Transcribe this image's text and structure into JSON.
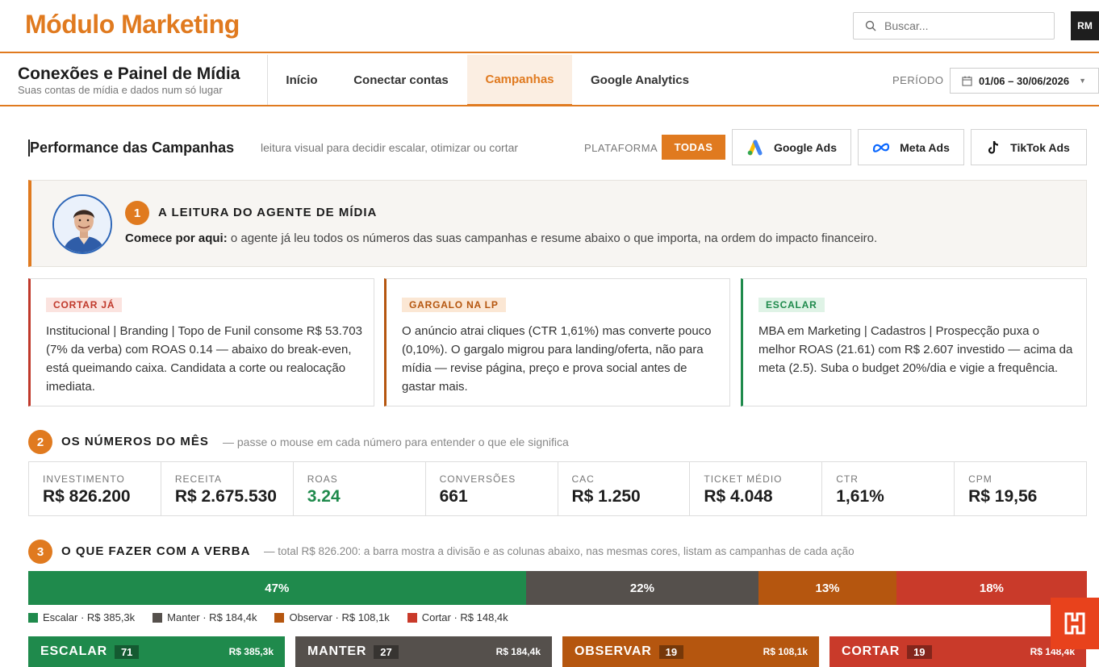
{
  "app": {
    "title": "Módulo Marketing",
    "user_initials": "RM"
  },
  "search": {
    "placeholder": "Buscar..."
  },
  "nav": {
    "brand_title": "Conexões e Painel de Mídia",
    "brand_subtitle": "Suas contas de mídia e dados num só lugar",
    "tabs": [
      {
        "label": "Início",
        "active": false
      },
      {
        "label": "Conectar contas",
        "active": false
      },
      {
        "label": "Campanhas",
        "active": true
      },
      {
        "label": "Google Analytics",
        "active": false
      }
    ],
    "period_label": "PERÍODO",
    "period_value": "01/06 – 30/06/2026"
  },
  "performance": {
    "title": "Performance das Campanhas",
    "subtitle": "leitura visual para decidir escalar, otimizar ou cortar",
    "platform_label": "PLATAFORMA",
    "platforms": [
      {
        "label": "TODAS",
        "icon": "none",
        "active": true
      },
      {
        "label": "Google Ads",
        "icon": "google-ads-icon",
        "active": false
      },
      {
        "label": "Meta Ads",
        "icon": "meta-icon",
        "active": false
      },
      {
        "label": "TikTok Ads",
        "icon": "tiktok-icon",
        "active": false
      }
    ]
  },
  "agent": {
    "step": "1",
    "heading": "A LEITURA DO AGENTE DE MÍDIA",
    "lead": "Comece por aqui:",
    "text": "o agente já leu todos os números das suas campanhas e resume abaixo o que importa, na ordem do impacto financeiro."
  },
  "insights": [
    {
      "tag": "CORTAR JÁ",
      "color": "#c0392b",
      "tag_bg": "#fbe3df",
      "text": "Institucional | Branding | Topo de Funil consome R$ 53.703 (7% da verba) com ROAS 0.14 — abaixo do break-even, está queimando caixa. Candidata a corte ou realocação imediata."
    },
    {
      "tag": "GARGALO NA LP",
      "color": "#b5560f",
      "tag_bg": "#fbe7d4",
      "text": "O anúncio atrai cliques (CTR 1,61%) mas converte pouco (0,10%). O gargalo migrou para landing/oferta, não para mídia — revise página, preço e prova social antes de gastar mais."
    },
    {
      "tag": "ESCALAR",
      "color": "#1f8a4c",
      "tag_bg": "#dff3e6",
      "text": "MBA em Marketing | Cadastros | Prospecção puxa o melhor ROAS (21.61) com R$ 2.607 investido — acima da meta (2.5). Suba o budget 20%/dia e vigie a frequência."
    }
  ],
  "numbers": {
    "step": "2",
    "title": "OS NÚMEROS DO MÊS",
    "subtitle": "— passe o mouse em cada número para entender o que ele significa",
    "kpis": [
      {
        "label": "INVESTIMENTO",
        "value": "R$ 826.200"
      },
      {
        "label": "RECEITA",
        "value": "R$ 2.675.530"
      },
      {
        "label": "ROAS",
        "value": "3.24",
        "good": true
      },
      {
        "label": "CONVERSÕES",
        "value": "661"
      },
      {
        "label": "CAC",
        "value": "R$ 1.250"
      },
      {
        "label": "TICKET MÉDIO",
        "value": "R$ 4.048"
      },
      {
        "label": "CTR",
        "value": "1,61%"
      },
      {
        "label": "CPM",
        "value": "R$ 19,56"
      }
    ]
  },
  "budget": {
    "step": "3",
    "title": "O QUE FAZER COM A VERBA",
    "subtitle": "— total R$ 826.200: a barra mostra a divisão e as colunas abaixo, nas mesmas cores, listam as campanhas de cada ação",
    "segments": [
      {
        "label": "47%",
        "share": 47,
        "color": "#1f8a4c",
        "legend": "Escalar · R$ 385,3k"
      },
      {
        "label": "22%",
        "share": 22,
        "color": "#55504c",
        "legend": "Manter · R$ 184,4k"
      },
      {
        "label": "13%",
        "share": 13,
        "color": "#b5560f",
        "legend": "Observar · R$ 108,1k"
      },
      {
        "label": "18%",
        "share": 18,
        "color": "#c93a2a",
        "legend": "Cortar · R$ 148,4k"
      }
    ],
    "columns": [
      {
        "name": "ESCALAR",
        "count": "71",
        "amount": "R$ 385,3k",
        "color": "#1f8a4c"
      },
      {
        "name": "MANTER",
        "count": "27",
        "amount": "R$ 184,4k",
        "color": "#55504c"
      },
      {
        "name": "OBSERVAR",
        "count": "19",
        "amount": "R$ 108,1k",
        "color": "#b5560f"
      },
      {
        "name": "CORTAR",
        "count": "19",
        "amount": "R$ 148,4k",
        "color": "#c93a2a"
      }
    ]
  }
}
